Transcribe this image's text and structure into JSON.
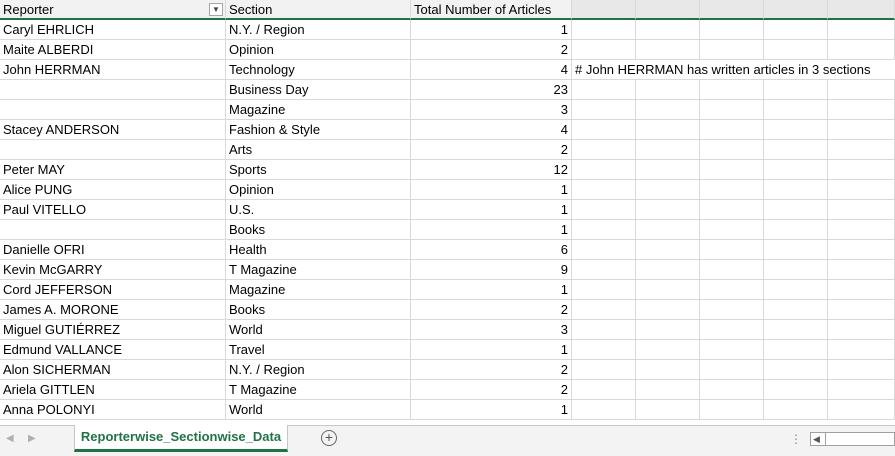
{
  "headers": {
    "reporter": "Reporter",
    "section": "Section",
    "total": "Total Number of Articles"
  },
  "filter_icon": "dropdown-arrow-icon",
  "rows": [
    {
      "reporter": "Caryl EHRLICH",
      "section": "N.Y. / Region",
      "total": "1",
      "note": ""
    },
    {
      "reporter": "Maite ALBERDI",
      "section": "Opinion",
      "total": "2",
      "note": ""
    },
    {
      "reporter": "John HERRMAN",
      "section": "Technology",
      "total": "4",
      "note": "# John HERRMAN has written articles in 3 sections"
    },
    {
      "reporter": "",
      "section": "Business Day",
      "total": "23",
      "note": ""
    },
    {
      "reporter": "",
      "section": "Magazine",
      "total": "3",
      "note": ""
    },
    {
      "reporter": "Stacey ANDERSON",
      "section": "Fashion & Style",
      "total": "4",
      "note": ""
    },
    {
      "reporter": "",
      "section": "Arts",
      "total": "2",
      "note": ""
    },
    {
      "reporter": "Peter MAY",
      "section": "Sports",
      "total": "12",
      "note": ""
    },
    {
      "reporter": "Alice PUNG",
      "section": "Opinion",
      "total": "1",
      "note": ""
    },
    {
      "reporter": "Paul VITELLO",
      "section": "U.S.",
      "total": "1",
      "note": ""
    },
    {
      "reporter": "",
      "section": "Books",
      "total": "1",
      "note": ""
    },
    {
      "reporter": "Danielle OFRI",
      "section": "Health",
      "total": "6",
      "note": ""
    },
    {
      "reporter": "Kevin McGARRY",
      "section": "T Magazine",
      "total": "9",
      "note": ""
    },
    {
      "reporter": "Cord JEFFERSON",
      "section": "Magazine",
      "total": "1",
      "note": ""
    },
    {
      "reporter": "James A. MORONE",
      "section": "Books",
      "total": "2",
      "note": ""
    },
    {
      "reporter": "Miguel GUTIÉRREZ",
      "section": "World",
      "total": "3",
      "note": ""
    },
    {
      "reporter": "Edmund VALLANCE",
      "section": "Travel",
      "total": "1",
      "note": ""
    },
    {
      "reporter": "Alon SICHERMAN",
      "section": "N.Y. / Region",
      "total": "2",
      "note": ""
    },
    {
      "reporter": "Ariela GITTLEN",
      "section": "T Magazine",
      "total": "2",
      "note": ""
    },
    {
      "reporter": "Anna POLONYI",
      "section": "World",
      "total": "1",
      "note": ""
    }
  ],
  "sheet_tabs": [
    {
      "label": "Reporterwise_Sectionwise_Data",
      "active": true
    }
  ],
  "icons": {
    "prev_sheet": "chevron-left-icon",
    "next_sheet": "chevron-right-icon",
    "add_sheet": "plus-circle-icon",
    "more": "more-dots-icon",
    "scroll_left": "scroll-left-icon"
  },
  "colors": {
    "accent": "#217346",
    "gridline": "#d9d9d9",
    "header_bg": "#f2f2f2"
  }
}
